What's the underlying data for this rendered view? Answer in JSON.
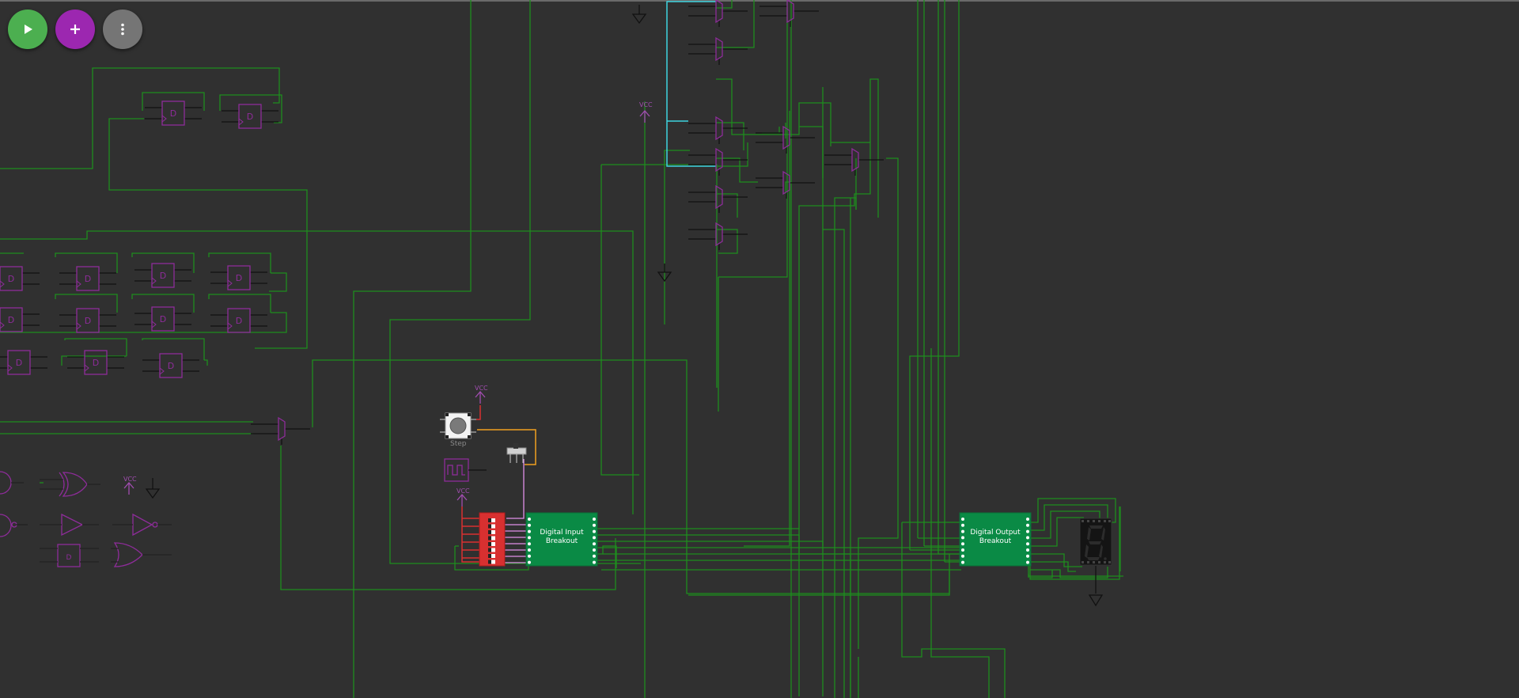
{
  "toolbar": {
    "run_button": {
      "icon": "play-icon",
      "color": "#4caf50"
    },
    "add_button": {
      "icon": "plus-icon",
      "color": "#9c27b0"
    },
    "more_button": {
      "icon": "more-vertical-icon",
      "color": "#757575"
    }
  },
  "canvas": {
    "background": "#303030",
    "wire_color": "#1e8c1e",
    "component_color": "#8e2c9a",
    "selected_wire_color": "#3ed4e0",
    "power_wire_color": "#e03030",
    "clock_wire_color": "#f0a020",
    "data_wire_color": "#e090e8"
  },
  "labels": {
    "vcc": "VCC",
    "step_label": "Step",
    "input_breakout_label": "Digital Input Breakout",
    "output_breakout_label": "Digital Output Breakout",
    "flip_flop_letter": "D"
  },
  "components": {
    "flip_flop_count": 15,
    "mux_count": 11,
    "seven_segment_display": "8"
  }
}
